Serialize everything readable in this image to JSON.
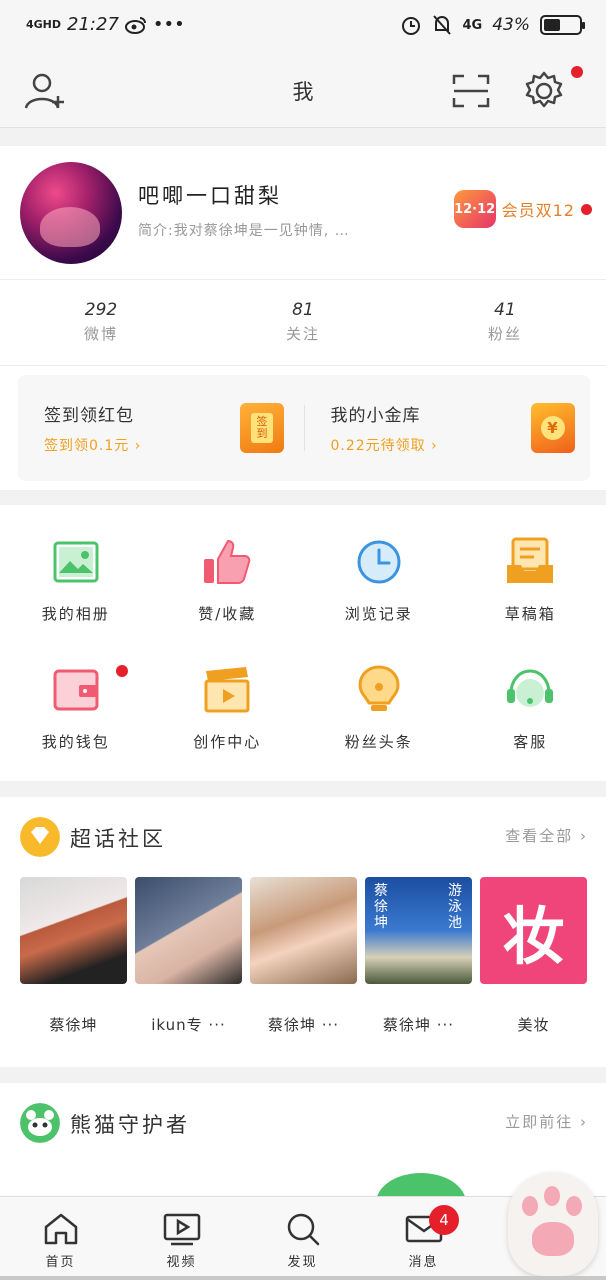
{
  "status_bar": {
    "network": "4GHD",
    "time": "21:27",
    "weibo_icon": "weibo-icon",
    "more": "•••",
    "right_network": "4G",
    "battery": "43%",
    "battery_level": 0.43
  },
  "header": {
    "title": "我",
    "add_friend_icon": "add-friend-icon",
    "scan_icon": "scan-icon",
    "settings_icon": "gear-icon"
  },
  "profile": {
    "username": "吧唧一口甜梨",
    "bio": "简介:我对蔡徐坤是一见钟情, …",
    "vip_badge": "12·12",
    "vip_text": "会员双12",
    "stats": [
      {
        "value": "292",
        "label": "微博"
      },
      {
        "value": "81",
        "label": "关注"
      },
      {
        "value": "41",
        "label": "粉丝"
      }
    ]
  },
  "promo": [
    {
      "title": "签到领红包",
      "sub": "签到领0.1元 ›",
      "img_text": "签到"
    },
    {
      "title": "我的小金库",
      "sub": "0.22元待领取 ›",
      "img_text": "¥"
    }
  ],
  "grid": [
    {
      "label": "我的相册",
      "icon": "photo-album-icon"
    },
    {
      "label": "赞/收藏",
      "icon": "thumbs-up-icon"
    },
    {
      "label": "浏览记录",
      "icon": "history-clock-icon"
    },
    {
      "label": "草稿箱",
      "icon": "drafts-box-icon"
    },
    {
      "label": "我的钱包",
      "icon": "wallet-icon"
    },
    {
      "label": "创作中心",
      "icon": "creator-clapper-icon"
    },
    {
      "label": "粉丝头条",
      "icon": "fans-headline-icon"
    },
    {
      "label": "客服",
      "icon": "customer-service-icon"
    }
  ],
  "topics": {
    "title": "超话社区",
    "more": "查看全部 ›",
    "items": [
      {
        "label": "蔡徐坤"
      },
      {
        "label": "ikun专 ···"
      },
      {
        "label": "蔡徐坤 ···"
      },
      {
        "label": "蔡徐坤 ···"
      },
      {
        "label": "美妆",
        "img_text": "妆"
      }
    ],
    "thumb4_text": [
      "蔡徐坤",
      "游泳池"
    ]
  },
  "panda": {
    "title": "熊猫守护者",
    "more": "立即前往 ›"
  },
  "nav": [
    {
      "label": "首页",
      "icon": "home-icon"
    },
    {
      "label": "视频",
      "icon": "video-icon"
    },
    {
      "label": "发现",
      "icon": "discover-search-icon"
    },
    {
      "label": "消息",
      "icon": "message-mail-icon",
      "badge": "4"
    },
    {
      "label": "",
      "icon": "cat-paw-icon"
    }
  ],
  "colors": {
    "accent_red": "#e5202a",
    "accent_orange": "#f0a020",
    "green": "#4cc36a"
  }
}
